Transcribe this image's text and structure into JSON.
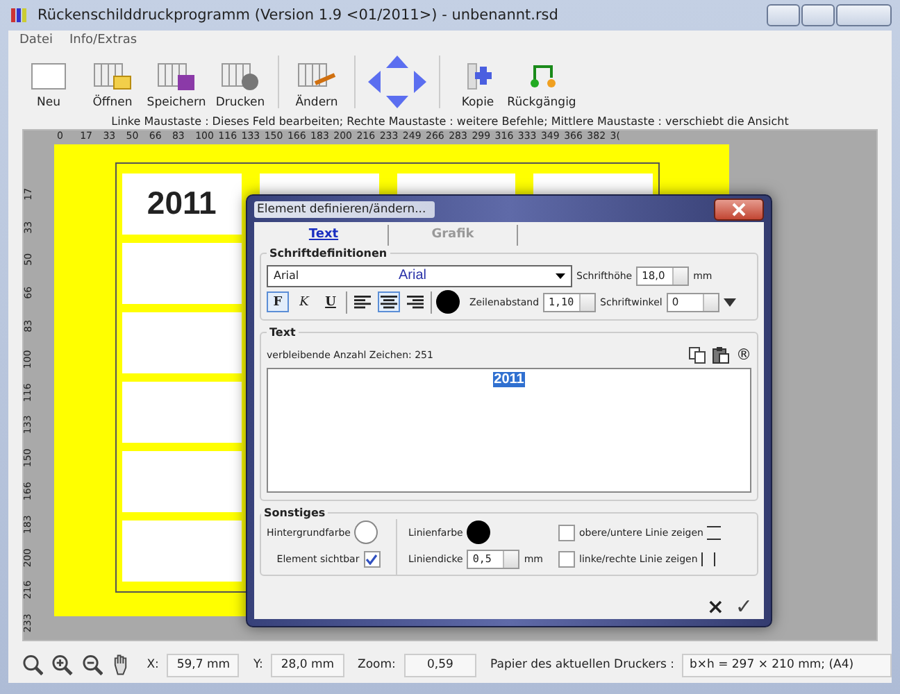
{
  "window": {
    "title": "Rückenschilddruckprogramm (Version 1.9 <01/2011>) - unbenannt.rsd"
  },
  "menu": [
    {
      "label": "Datei"
    },
    {
      "label": "Info/Extras"
    }
  ],
  "toolbar": [
    {
      "kind": "new",
      "label": "Neu"
    },
    {
      "kind": "open",
      "label": "Öffnen"
    },
    {
      "kind": "save",
      "label": "Speichern"
    },
    {
      "kind": "print",
      "label": "Drucken"
    },
    {
      "kind": "edit",
      "label": "Ändern"
    },
    {
      "kind": "move"
    },
    {
      "kind": "copy",
      "label": "Kopie"
    },
    {
      "kind": "undo",
      "label": "Rückgängig"
    }
  ],
  "hint": "Linke Maustaste : Dieses Feld bearbeiten;  Rechte Maustaste : weitere Befehle;  Mittlere Maustaste : verschiebt die Ansicht",
  "canvas": {
    "top_ruler": [
      "0",
      "17",
      "33",
      "50",
      "66",
      "83",
      "100",
      "116",
      "133",
      "150",
      "166",
      "183",
      "200",
      "216",
      "233",
      "249",
      "266",
      "283",
      "299",
      "316",
      "333",
      "349",
      "366",
      "382",
      "3("
    ],
    "left_ruler": [
      "17",
      "33",
      "50",
      "66",
      "83",
      "100",
      "116",
      "133",
      "150",
      "166",
      "183",
      "200",
      "216",
      "233"
    ],
    "first_label": "2011"
  },
  "dialog": {
    "title": "Element definieren/ändern...",
    "tabs": [
      {
        "label": "Text",
        "selected": true
      },
      {
        "label": "Grafik",
        "selected": false
      }
    ],
    "font_group": {
      "title": "Schriftdefinitionen",
      "font_name": "Arial",
      "font_preview": "Arial",
      "height_label": "Schrifthöhe",
      "height_value": "18,0",
      "height_unit": "mm",
      "styles": [
        {
          "label": "F",
          "kind": "bold",
          "selected": true
        },
        {
          "label": "K",
          "kind": "italic",
          "selected": false
        },
        {
          "label": "U",
          "kind": "underline",
          "selected": false
        }
      ],
      "aligns": [
        {
          "kind": "left",
          "selected": false
        },
        {
          "kind": "center",
          "selected": true
        },
        {
          "kind": "right",
          "selected": false
        }
      ],
      "spacing_label": "Zeilenabstand",
      "spacing_value": "1,10",
      "angle_label": "Schriftwinkel",
      "angle_value": "0"
    },
    "text_group": {
      "title": "Text",
      "remaining": "verbleibende Anzahl Zeichen: 251",
      "symbol": "®",
      "value": "2011"
    },
    "misc_group": {
      "title": "Sonstiges",
      "background_label": "Hintergrundfarbe",
      "visible_label": "Element sichtbar",
      "visible": true,
      "line_color_label": "Linienfarbe",
      "line_width_label": "Liniendicke",
      "line_width_value": "0,5",
      "line_width_unit": "mm",
      "options": [
        {
          "label": "obere/untere Linie zeigen",
          "checked": false,
          "kind": "horizontal"
        },
        {
          "label": "linke/rechte Linie zeigen",
          "checked": false,
          "kind": "vertical"
        }
      ]
    },
    "cancel": "×",
    "ok": "✓"
  },
  "status_bar": {
    "x_label": "X:",
    "x_value": "59,7 mm",
    "y_label": "Y:",
    "y_value": "28,0 mm",
    "zoom_label": "Zoom:",
    "zoom_value": "0,59",
    "paper_label": "Papier des aktuellen Druckers :",
    "paper_value": "b×h = 297 × 210 mm; (A4)"
  }
}
